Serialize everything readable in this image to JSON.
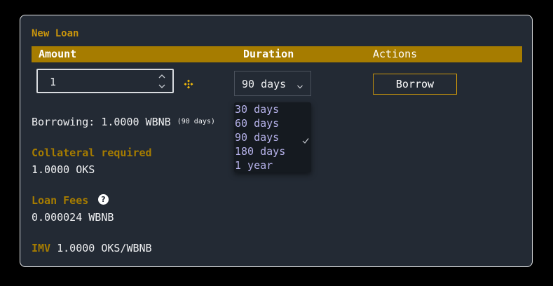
{
  "section_title": "New Loan",
  "columns": {
    "amount": "Amount",
    "duration": "Duration",
    "actions": "Actions"
  },
  "amount_input": {
    "value": "1"
  },
  "duration_select": {
    "selected": "90 days",
    "options": [
      "30 days",
      "60 days",
      "90 days",
      "180 days",
      "1 year"
    ]
  },
  "borrow_button": "Borrow",
  "borrowing": {
    "label": "Borrowing: 1.0000 WBNB",
    "duration_note": "(90 days)"
  },
  "collateral": {
    "label": "Collateral required",
    "value": "1.0000 OKS"
  },
  "loan_fees": {
    "label": "Loan Fees",
    "help_glyph": "?",
    "value": "0.000024 WBNB"
  },
  "imv": {
    "label": "IMV",
    "value": "1.0000 OKS/WBNB"
  },
  "colors": {
    "accent_gold": "#a67c00",
    "panel_bg": "#232a34",
    "dropdown_text": "#b6b2ea"
  },
  "icons": {
    "token": "binance-coin-icon",
    "stepper": "up-down-chevron-icon",
    "select": "chevron-down-icon",
    "selected_option": "checkmark-icon",
    "help": "question-circle-icon"
  }
}
